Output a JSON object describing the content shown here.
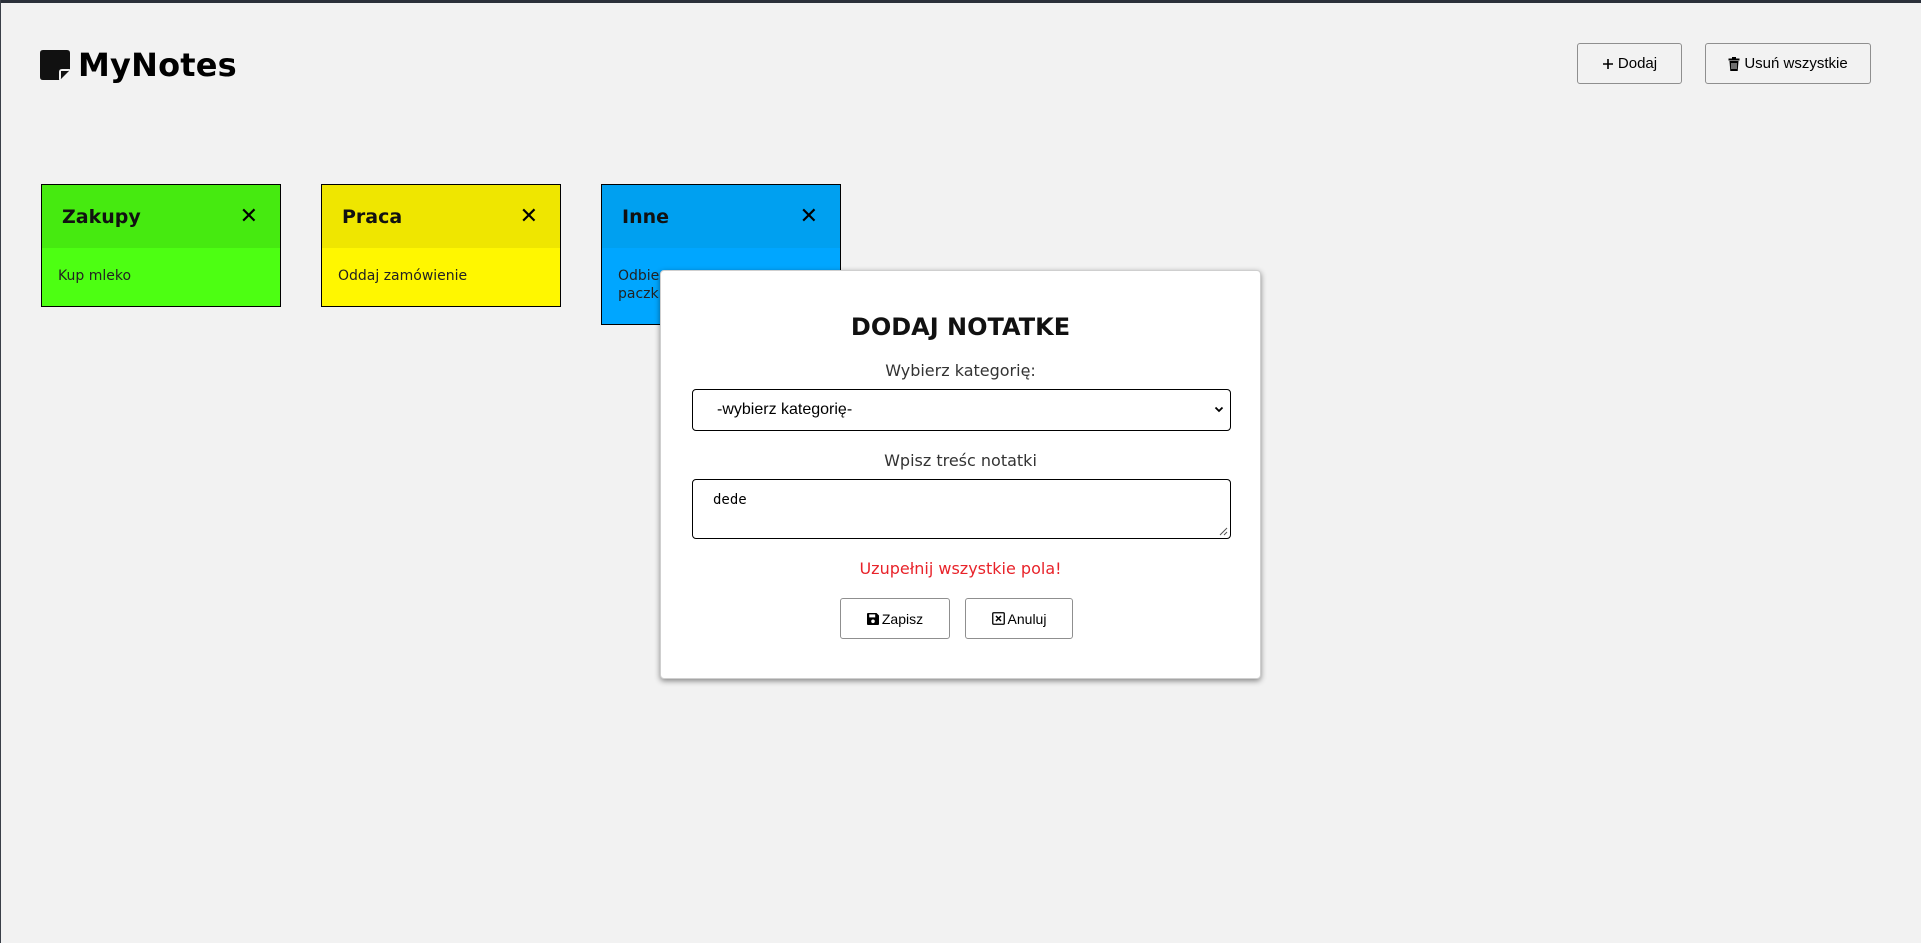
{
  "app": {
    "logo_text": "MyNotes"
  },
  "header": {
    "add_label": "Dodaj",
    "delete_all_label": "Usuń wszystkie"
  },
  "notes": [
    {
      "title": "Zakupy",
      "content": "Kup mleko",
      "color": "#4dff12"
    },
    {
      "title": "Praca",
      "content": "Oddaj zamówienie",
      "color": "#fff700"
    },
    {
      "title": "Inne",
      "content_visible_line1": "Odbie",
      "content_visible_line2": "paczk",
      "color": "#00a6ff"
    }
  ],
  "modal": {
    "title": "DODAJ NOTATKE",
    "category_label": "Wybierz kategorię:",
    "category_selected": "-wybierz kategorię-",
    "content_label": "Wpisz treśc notatki",
    "content_value": "dede",
    "error_message": "Uzupełnij wszystkie pola!",
    "save_label": "Zapisz",
    "cancel_label": "Anuluj"
  },
  "colors": {
    "background": "#f2f2f2",
    "error": "#e8232a"
  },
  "icons": {
    "logo": "note-icon",
    "add": "plus-icon",
    "delete_all": "trash-icon",
    "note_close": "close-icon",
    "save": "floppy-disk-icon",
    "cancel": "x-box-icon",
    "select": "chevron-down-icon"
  }
}
